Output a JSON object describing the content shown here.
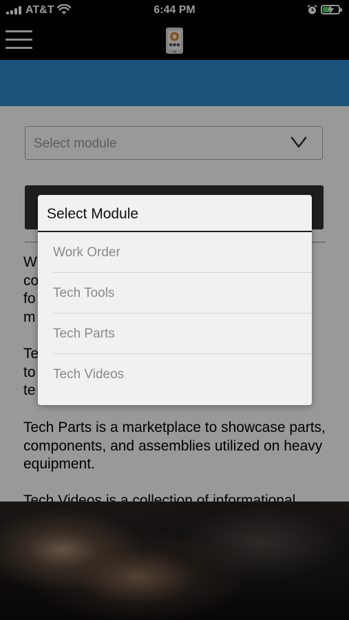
{
  "status_bar": {
    "carrier": "AT&T",
    "time": "6:44 PM",
    "icons": [
      "signal-icon",
      "wifi-icon",
      "alarm-icon",
      "battery-charging-icon"
    ]
  },
  "header": {
    "menu_icon": "hamburger-icon",
    "logo_icon": "app-logo-icon"
  },
  "colors": {
    "banner": "#2b8bcf",
    "app_bar": "#000000",
    "button": "#333333"
  },
  "module_select": {
    "placeholder": "Select module"
  },
  "descriptions": [
    "W\nco\nfo\nm",
    "Te\nto\nte",
    "Tech Parts is a marketplace to showcase parts, components, and assemblies utilized on heavy equipment.",
    "Tech Videos is a collection of informational"
  ],
  "modal": {
    "title": "Select Module",
    "options": [
      "Work Order",
      "Tech Tools",
      "Tech Parts",
      "Tech Videos"
    ]
  }
}
